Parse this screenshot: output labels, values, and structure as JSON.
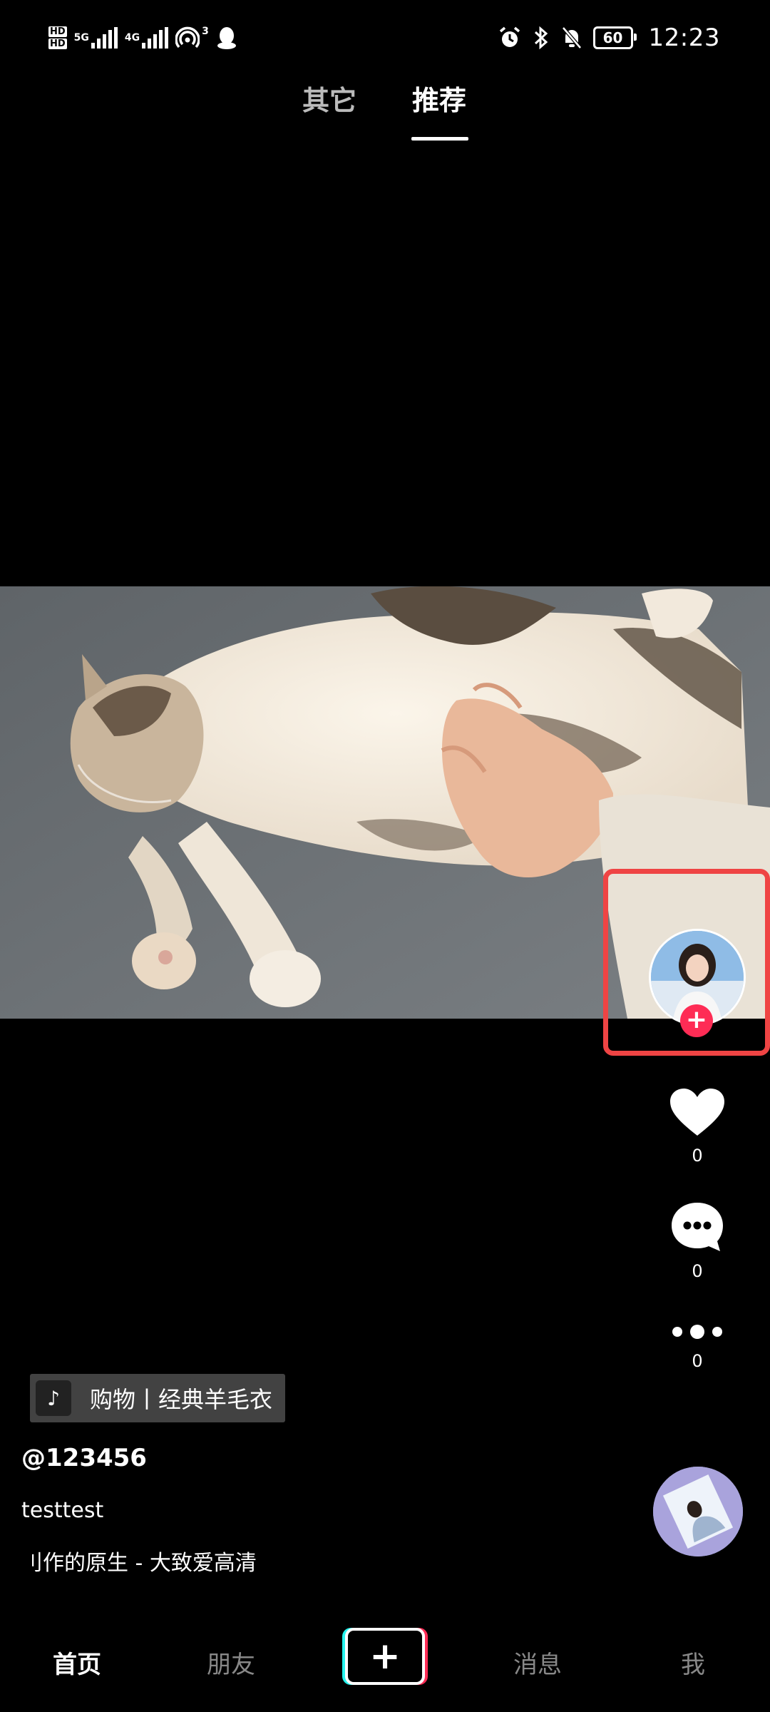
{
  "status_bar": {
    "hd1": "HD",
    "hd2": "HD",
    "net1": "5G",
    "net2": "4G",
    "hotspot_count": "3",
    "battery": "60",
    "time": "12:23"
  },
  "top_tabs": {
    "other": "其它",
    "recommend": "推荐"
  },
  "video": {
    "subject": "cat-belly-rub"
  },
  "actions": {
    "like_count": "0",
    "comment_count": "0",
    "share_count": "0",
    "follow_symbol": "+"
  },
  "shop_tag": {
    "logo_glyph": "♪",
    "label": "购物丨经典羊毛衣"
  },
  "post": {
    "author": "@123456",
    "description": "testtest",
    "music": "刂作的原生 - 大致爱高清"
  },
  "bottom_nav": {
    "home": "首页",
    "friends": "朋友",
    "add_symbol": "+",
    "messages": "消息",
    "me": "我"
  },
  "colors": {
    "highlight": "#ef4444",
    "follow_accent": "#fe2c55",
    "cyan_accent": "#25f4ee"
  }
}
